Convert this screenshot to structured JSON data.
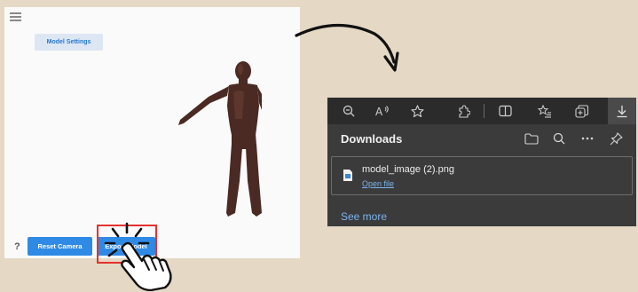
{
  "viewer": {
    "settings_label": "Model Settings",
    "help_label": "?",
    "reset_label": "Reset Camera",
    "export_label": "Export Model"
  },
  "browser": {
    "toolbar_icons": [
      "zoom-out-icon",
      "read-aloud-icon",
      "favorite-star-icon",
      "extensions-icon",
      "split-screen-icon",
      "favorites-list-icon",
      "collections-icon",
      "download-icon"
    ],
    "downloads_title": "Downloads",
    "header_icons": [
      "folder-icon",
      "search-icon",
      "more-icon",
      "pin-icon"
    ],
    "item": {
      "file_name": "model_image (2).png",
      "open_label": "Open file"
    },
    "see_more_label": "See more"
  },
  "colors": {
    "page_bg": "#e5d8c4",
    "button_blue": "#2f8ae6",
    "highlight_red": "#e5322d",
    "browser_bg": "#3b3b3b",
    "link_blue": "#7ab3f0"
  }
}
